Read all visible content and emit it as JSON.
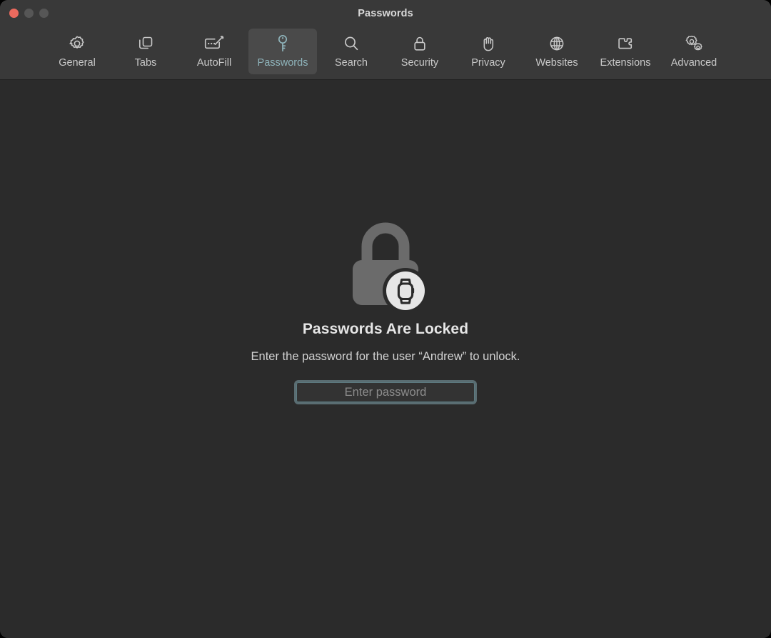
{
  "window": {
    "title": "Passwords",
    "controls": [
      {
        "name": "close",
        "color": "#ec6a5e"
      },
      {
        "name": "minimize",
        "color": "#565656"
      },
      {
        "name": "zoom",
        "color": "#565656"
      }
    ],
    "background": "#2b2b2b",
    "titlebar_background": "#393939"
  },
  "toolbar": {
    "active_tab": "Passwords",
    "accent_color": "#8fb4bb",
    "active_tab_background": "#4a4a4a",
    "tabs": [
      {
        "label": "General",
        "icon": "gear-icon"
      },
      {
        "label": "Tabs",
        "icon": "tabs-icon"
      },
      {
        "label": "AutoFill",
        "icon": "autofill-icon"
      },
      {
        "label": "Passwords",
        "icon": "key-icon"
      },
      {
        "label": "Search",
        "icon": "search-icon"
      },
      {
        "label": "Security",
        "icon": "padlock-icon"
      },
      {
        "label": "Privacy",
        "icon": "hand-icon"
      },
      {
        "label": "Websites",
        "icon": "globe-icon"
      },
      {
        "label": "Extensions",
        "icon": "puzzle-piece-icon"
      },
      {
        "label": "Advanced",
        "icon": "double-gear-icon"
      }
    ]
  },
  "main": {
    "graphic": "locked-padlock-with-watch-badge-icon",
    "heading": "Passwords Are Locked",
    "message": "Enter the password for the user “Andrew” to unlock.",
    "user_name": "Andrew",
    "password_field": {
      "value": "",
      "placeholder": "Enter password",
      "focused": true,
      "focus_ring_color": "#7a9da5"
    }
  }
}
